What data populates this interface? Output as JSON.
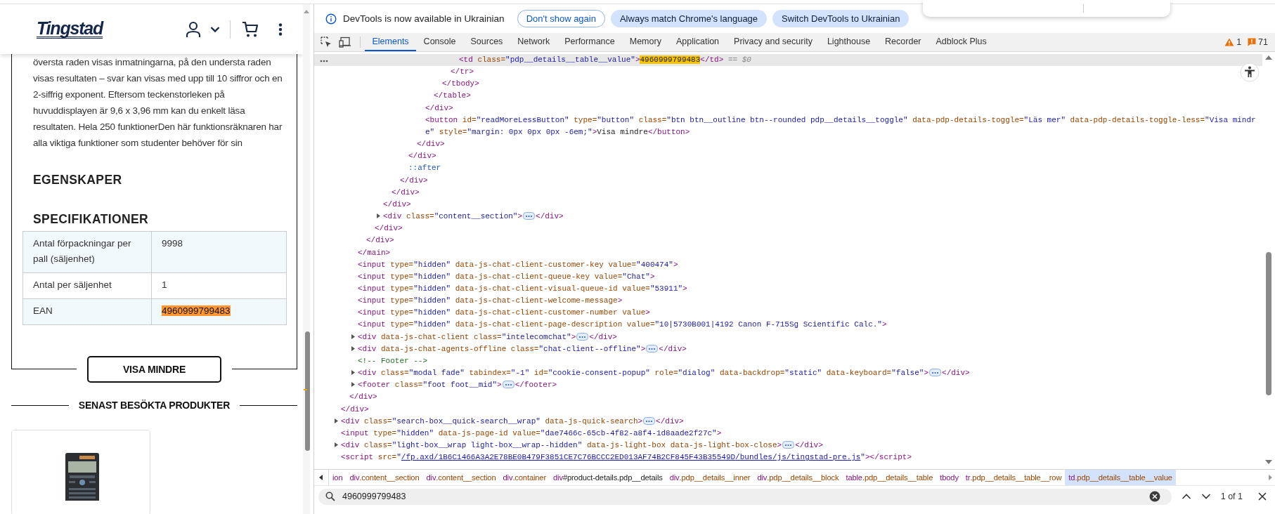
{
  "page": {
    "logo": "Tingstad",
    "description": "översta raden visas inmatningarna, på den understa raden visas resultaten – svar kan visas med upp till 10 siffror och en 2-siffrig exponent. Eftersom teckenstorleken på huvuddisplayen är 9,6 x 3,96 mm kan du enkelt läsa resultaten. Hela 250 funktionerDen här funktionsräknaren har alla viktiga funktioner som studenter behöver för sin",
    "headings": [
      "EGENSKAPER",
      "SPECIFIKATIONER"
    ],
    "spec_rows": [
      {
        "label": "Antal förpackningar per pall (säljenhet)",
        "value": "9998",
        "highlighted": false
      },
      {
        "label": "Antal per säljenhet",
        "value": "1",
        "highlighted": false
      },
      {
        "label": "EAN",
        "value": "4960999799483",
        "highlighted": true
      }
    ],
    "toggle_button": "VISA MINDRE",
    "recent_heading": "SENAST BESÖKTA PRODUKTER",
    "recent_products": [
      {
        "kind": "picture"
      }
    ]
  },
  "devtools": {
    "infobar": {
      "message": "DevTools is now available in Ukrainian",
      "buttons": [
        {
          "label": "Don't show again",
          "kind": "outline"
        },
        {
          "label": "Always match Chrome's language",
          "kind": "filled"
        },
        {
          "label": "Switch DevTools to Ukrainian",
          "kind": "filled"
        }
      ]
    },
    "tabs": [
      {
        "label": "Elements",
        "selected": true
      },
      {
        "label": "Console",
        "selected": false
      },
      {
        "label": "Sources",
        "selected": false
      },
      {
        "label": "Network",
        "selected": false
      },
      {
        "label": "Performance",
        "selected": false
      },
      {
        "label": "Memory",
        "selected": false
      },
      {
        "label": "Application",
        "selected": false
      },
      {
        "label": "Privacy and security",
        "selected": false
      },
      {
        "label": "Lighthouse",
        "selected": false
      },
      {
        "label": "Recorder",
        "selected": false
      },
      {
        "label": "Adblock Plus",
        "selected": false
      }
    ],
    "warnings": "1",
    "issues": "71",
    "dom_tree": [
      {
        "kind": "close",
        "selected": false,
        "code": [
          {
            "kind": "tag",
            "text": "</div>"
          }
        ],
        "children": [
          {
            "kind": "close",
            "selected": false,
            "code": [
              {
                "kind": "tag",
                "text": "</div>"
              }
            ],
            "children": [
              {
                "kind": "close",
                "selected": false,
                "code": [
                  {
                    "kind": "tag",
                    "text": "</main>"
                  }
                ],
                "children": [
                  {
                    "kind": "close",
                    "selected": false,
                    "code": [
                      {
                        "kind": "tag",
                        "text": "</div>"
                      }
                    ],
                    "children": [
                      {
                        "kind": "close",
                        "selected": false,
                        "code": [
                          {
                            "kind": "tag",
                            "text": "</div>"
                          }
                        ],
                        "children": [
                          {
                            "kind": "close",
                            "selected": false,
                            "code": [
                              {
                                "kind": "tag",
                                "text": "</div>"
                              }
                            ],
                            "children": [
                              {
                                "kind": "close",
                                "selected": false,
                                "code": [
                                  {
                                    "kind": "tag",
                                    "text": "</div>"
                                  }
                                ],
                                "children": [
                                  {
                                    "kind": "close",
                                    "selected": false,
                                    "code": [
                                      {
                                        "kind": "tag",
                                        "text": "</div>"
                                      }
                                    ],
                                    "children": [
                                      {
                                        "kind": "close",
                                        "selected": false,
                                        "code": [
                                          {
                                            "kind": "tag",
                                            "text": "</div>"
                                          }
                                        ],
                                        "children": [
                                          {
                                            "kind": "close",
                                            "selected": false,
                                            "code": [
                                              {
                                                "kind": "tag",
                                                "text": "</div>"
                                              }
                                            ],
                                            "children": [
                                              {
                                                "kind": "close",
                                                "selected": false,
                                                "code": [
                                                  {
                                                    "kind": "tag",
                                                    "text": "</div>"
                                                  }
                                                ],
                                                "children": [
                                                  {
                                                    "kind": "close",
                                                    "selected": false,
                                                    "code": [
                                                      {
                                                        "kind": "tag",
                                                        "text": "</table>"
                                                      }
                                                    ],
                                                    "children": [
                                                      {
                                                        "kind": "close",
                                                        "selected": false,
                                                        "code": [
                                                          {
                                                            "kind": "tag",
                                                            "text": "</tbody>"
                                                          }
                                                        ],
                                                        "children": [
                                                          {
                                                            "kind": "close",
                                                            "selected": false,
                                                            "code": [
                                                              {
                                                                "kind": "tag",
                                                                "text": "</tr>"
                                                              }
                                                            ],
                                                            "children": [
                                                              {
                                                                "selected": true,
                                                                "code": [
                                                                  {
                                                                    "kind": "tag",
                                                                    "text": "<td"
                                                                  },
                                                                  {
                                                                    "kind": "attr",
                                                                    "text": " class="
                                                                  },
                                                                  {
                                                                    "kind": "value",
                                                                    "text": "\"pdp__details__table__value\""
                                                                  },
                                                                  {
                                                                    "kind": "tag",
                                                                    "text": ">"
                                                                  },
                                                                  {
                                                                    "kind": "match",
                                                                    "text": "4960999799483"
                                                                  },
                                                                  {
                                                                    "kind": "tag",
                                                                    "text": "</td>"
                                                                  },
                                                                  {
                                                                    "kind": "note",
                                                                    "text": " == $0"
                                                                  }
                                                                ]
                                                              }
                                                            ]
                                                          }
                                                        ]
                                                      }
                                                    ]
                                                  }
                                                ]
                                              },
                                              {
                                                "selected": false,
                                                "code": [
                                                  {
                                                    "kind": "tag",
                                                    "text": "<button"
                                                  },
                                                  {
                                                    "kind": "attr",
                                                    "text": " id="
                                                  },
                                                  {
                                                    "kind": "value",
                                                    "text": "\"readMoreLessButton\""
                                                  },
                                                  {
                                                    "kind": "attr",
                                                    "text": " type="
                                                  },
                                                  {
                                                    "kind": "value",
                                                    "text": "\"button\""
                                                  },
                                                  {
                                                    "kind": "attr",
                                                    "text": " class="
                                                  },
                                                  {
                                                    "kind": "value",
                                                    "text": "\"btn btn__outline btn--rounded pdp__details__toggle\""
                                                  },
                                                  {
                                                    "kind": "attr",
                                                    "text": " data-pdp-details-toggle="
                                                  },
                                                  {
                                                    "kind": "value",
                                                    "text": "\"Läs mer\""
                                                  },
                                                  {
                                                    "kind": "attr",
                                                    "text": " data-pdp-details-toggle-less="
                                                  },
                                                  {
                                                    "kind": "value",
                                                    "text": "\"Visa mindre\""
                                                  },
                                                  {
                                                    "kind": "attr",
                                                    "text": " style="
                                                  },
                                                  {
                                                    "kind": "value",
                                                    "text": "\"margin: 0px 0px 0px -6em;\""
                                                  },
                                                  {
                                                    "kind": "tag",
                                                    "text": ">"
                                                  },
                                                  {
                                                    "kind": "text",
                                                    "text": "Visa mindre"
                                                  },
                                                  {
                                                    "kind": "tag",
                                                    "text": "</button>"
                                                  }
                                                ]
                                              }
                                            ]
                                          }
                                        ]
                                      },
                                      {
                                        "selected": false,
                                        "code": [
                                          {
                                            "kind": "pseudo",
                                            "text": "::after"
                                          }
                                        ]
                                      }
                                    ]
                                  }
                                ]
                              }
                            ]
                          },
                          {
                            "selected": false,
                            "expanded": false,
                            "code": [
                              {
                                "kind": "tag",
                                "text": "<div"
                              },
                              {
                                "kind": "attr",
                                "text": " class="
                              },
                              {
                                "kind": "value",
                                "text": "\"content__section\""
                              },
                              {
                                "kind": "tag",
                                "text": ">"
                              }
                            ],
                            "tail": [
                              {
                                "kind": "tag",
                                "text": "</div>"
                              }
                            ]
                          }
                        ]
                      }
                    ]
                  }
                ]
              },
              {
                "selected": false,
                "code": [
                  {
                    "kind": "tag",
                    "text": "<input"
                  },
                  {
                    "kind": "attr",
                    "text": " type="
                  },
                  {
                    "kind": "value",
                    "text": "\"hidden\""
                  },
                  {
                    "kind": "attr",
                    "text": " data-js-chat-client-customer-key value="
                  },
                  {
                    "kind": "value",
                    "text": "\"400474\""
                  },
                  {
                    "kind": "tag",
                    "text": ">"
                  }
                ]
              },
              {
                "selected": false,
                "code": [
                  {
                    "kind": "tag",
                    "text": "<input"
                  },
                  {
                    "kind": "attr",
                    "text": " type="
                  },
                  {
                    "kind": "value",
                    "text": "\"hidden\""
                  },
                  {
                    "kind": "attr",
                    "text": " data-js-chat-client-queue-key value="
                  },
                  {
                    "kind": "value",
                    "text": "\"Chat\""
                  },
                  {
                    "kind": "tag",
                    "text": ">"
                  }
                ]
              },
              {
                "selected": false,
                "code": [
                  {
                    "kind": "tag",
                    "text": "<input"
                  },
                  {
                    "kind": "attr",
                    "text": " type="
                  },
                  {
                    "kind": "value",
                    "text": "\"hidden\""
                  },
                  {
                    "kind": "attr",
                    "text": " data-js-chat-client-visual-queue-id value="
                  },
                  {
                    "kind": "value",
                    "text": "\"53911\""
                  },
                  {
                    "kind": "tag",
                    "text": ">"
                  }
                ]
              },
              {
                "selected": false,
                "code": [
                  {
                    "kind": "tag",
                    "text": "<input"
                  },
                  {
                    "kind": "attr",
                    "text": " type="
                  },
                  {
                    "kind": "value",
                    "text": "\"hidden\""
                  },
                  {
                    "kind": "attr",
                    "text": " data-js-chat-client-welcome-message"
                  },
                  {
                    "kind": "tag",
                    "text": ">"
                  }
                ]
              },
              {
                "selected": false,
                "code": [
                  {
                    "kind": "tag",
                    "text": "<input"
                  },
                  {
                    "kind": "attr",
                    "text": " type="
                  },
                  {
                    "kind": "value",
                    "text": "\"hidden\""
                  },
                  {
                    "kind": "attr",
                    "text": " data-js-chat-client-customer-number value"
                  },
                  {
                    "kind": "tag",
                    "text": ">"
                  }
                ]
              },
              {
                "selected": false,
                "code": [
                  {
                    "kind": "tag",
                    "text": "<input"
                  },
                  {
                    "kind": "attr",
                    "text": " type="
                  },
                  {
                    "kind": "value",
                    "text": "\"hidden\""
                  },
                  {
                    "kind": "attr",
                    "text": " data-js-chat-client-page-description value="
                  },
                  {
                    "kind": "value",
                    "text": "\"10|5730B001|4192 Canon F-715Sg Scientific Calc.\""
                  },
                  {
                    "kind": "tag",
                    "text": ">"
                  }
                ]
              },
              {
                "selected": false,
                "expanded": false,
                "code": [
                  {
                    "kind": "tag",
                    "text": "<div"
                  },
                  {
                    "kind": "attr",
                    "text": " data-js-chat-client class="
                  },
                  {
                    "kind": "value",
                    "text": "\"intelecomchat\""
                  },
                  {
                    "kind": "tag",
                    "text": ">"
                  }
                ],
                "tail": [
                  {
                    "kind": "tag",
                    "text": "</div>"
                  }
                ]
              },
              {
                "selected": false,
                "expanded": false,
                "code": [
                  {
                    "kind": "tag",
                    "text": "<div"
                  },
                  {
                    "kind": "attr",
                    "text": " data-js-chat-agents-offline class="
                  },
                  {
                    "kind": "value",
                    "text": "\"chat-client--offline\""
                  },
                  {
                    "kind": "tag",
                    "text": ">"
                  }
                ],
                "tail": [
                  {
                    "kind": "tag",
                    "text": "</div>"
                  }
                ]
              },
              {
                "selected": false,
                "code": [
                  {
                    "kind": "comment",
                    "text": "<!-- Footer -->"
                  }
                ]
              },
              {
                "selected": false,
                "expanded": false,
                "code": [
                  {
                    "kind": "tag",
                    "text": "<div"
                  },
                  {
                    "kind": "attr",
                    "text": " class="
                  },
                  {
                    "kind": "value",
                    "text": "\"modal fade\""
                  },
                  {
                    "kind": "attr",
                    "text": " tabindex="
                  },
                  {
                    "kind": "value",
                    "text": "\"-1\""
                  },
                  {
                    "kind": "attr",
                    "text": " id="
                  },
                  {
                    "kind": "value",
                    "text": "\"cookie-consent-popup\""
                  },
                  {
                    "kind": "attr",
                    "text": " role="
                  },
                  {
                    "kind": "value",
                    "text": "\"dialog\""
                  },
                  {
                    "kind": "attr",
                    "text": " data-backdrop="
                  },
                  {
                    "kind": "value",
                    "text": "\"static\""
                  },
                  {
                    "kind": "attr",
                    "text": " data-keyboard="
                  },
                  {
                    "kind": "value",
                    "text": "\"false\""
                  },
                  {
                    "kind": "tag",
                    "text": ">"
                  }
                ],
                "tail": [
                  {
                    "kind": "tag",
                    "text": "</div>"
                  }
                ]
              },
              {
                "selected": false,
                "expanded": false,
                "code": [
                  {
                    "kind": "tag",
                    "text": "<footer"
                  },
                  {
                    "kind": "attr",
                    "text": " class="
                  },
                  {
                    "kind": "value",
                    "text": "\"foot foot__mid\""
                  },
                  {
                    "kind": "tag",
                    "text": ">"
                  }
                ],
                "tail": [
                  {
                    "kind": "tag",
                    "text": "</footer>"
                  }
                ]
              }
            ]
          }
        ]
      },
      {
        "selected": false,
        "expanded": false,
        "code": [
          {
            "kind": "tag",
            "text": "<div"
          },
          {
            "kind": "attr",
            "text": " class="
          },
          {
            "kind": "value",
            "text": "\"search-box__quick-search__wrap\""
          },
          {
            "kind": "attr",
            "text": " data-js-quick-search"
          },
          {
            "kind": "tag",
            "text": ">"
          }
        ],
        "tail": [
          {
            "kind": "tag",
            "text": "</div>"
          }
        ]
      },
      {
        "selected": false,
        "code": [
          {
            "kind": "tag",
            "text": "<input"
          },
          {
            "kind": "attr",
            "text": " type="
          },
          {
            "kind": "value",
            "text": "\"hidden\""
          },
          {
            "kind": "attr",
            "text": " data-js-page-id value="
          },
          {
            "kind": "value",
            "text": "\"dae7466c-65cb-4f82-a8f4-1d8aade2f27c\""
          },
          {
            "kind": "tag",
            "text": ">"
          }
        ]
      },
      {
        "selected": false,
        "expanded": false,
        "code": [
          {
            "kind": "tag",
            "text": "<div"
          },
          {
            "kind": "attr",
            "text": " class="
          },
          {
            "kind": "value",
            "text": "\"light-box__wrap light-box__wrap--hidden\""
          },
          {
            "kind": "attr",
            "text": " data-js-light-box data-js-light-box-close"
          },
          {
            "kind": "tag",
            "text": ">"
          }
        ],
        "tail": [
          {
            "kind": "tag",
            "text": "</div>"
          }
        ]
      },
      {
        "selected": false,
        "code": [
          {
            "kind": "tag",
            "text": "<script"
          },
          {
            "kind": "attr",
            "text": " src="
          },
          {
            "kind": "value",
            "text": "\""
          },
          {
            "kind": "link",
            "text": "/fp.axd/1B6C1466A3A2E78BE0B479F3851CE7C76BCCC2ED013AF74B2CF845F43B35549D/bundles/js/tingstad-pre.js"
          },
          {
            "kind": "value",
            "text": "\""
          },
          {
            "kind": "tag",
            "text": ">"
          },
          {
            "kind": "tag",
            "text": "</script>"
          }
        ]
      }
    ],
    "breadcrumbs": [
      {
        "tag": "ion",
        "kind": "tag",
        "selected": false
      },
      {
        "tag": "div",
        "rest": ".content__section",
        "kind": "class",
        "selected": false
      },
      {
        "tag": "div",
        "rest": ".content__section",
        "kind": "class",
        "selected": false
      },
      {
        "tag": "div",
        "rest": ".container",
        "kind": "class",
        "selected": false
      },
      {
        "tag": "div",
        "rest": "#product-details.pdp__details",
        "kind": "id",
        "selected": false
      },
      {
        "tag": "div",
        "rest": ".pdp__details__inner",
        "kind": "class",
        "selected": false
      },
      {
        "tag": "div",
        "rest": ".pdp__details__block",
        "kind": "class",
        "selected": false
      },
      {
        "tag": "table",
        "rest": ".pdp__details__table",
        "kind": "class",
        "selected": false
      },
      {
        "tag": "tbody",
        "kind": "tag",
        "selected": false
      },
      {
        "tag": "tr",
        "rest": ".pdp__details__table__row",
        "kind": "class",
        "selected": false
      },
      {
        "tag": "td",
        "rest": ".pdp__details__table__value",
        "kind": "class",
        "selected": true
      }
    ],
    "search": {
      "value": "4960999799483",
      "result": "1 of 1"
    }
  }
}
